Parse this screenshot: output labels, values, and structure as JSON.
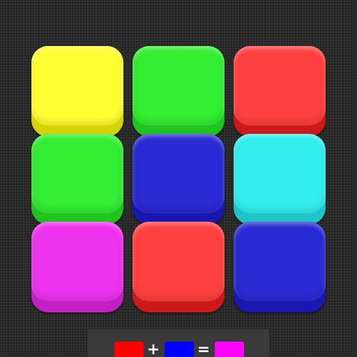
{
  "game": {
    "tiles": [
      {
        "color_name": "yellow",
        "top": "#ffff33",
        "side": "#d4d400"
      },
      {
        "color_name": "green",
        "top": "#33ee33",
        "side": "#1fc41f"
      },
      {
        "color_name": "red",
        "top": "#ff4040",
        "side": "#cc1a1a"
      },
      {
        "color_name": "green",
        "top": "#33ee33",
        "side": "#1fc41f"
      },
      {
        "color_name": "blue",
        "top": "#2a2ad4",
        "side": "#1818b0"
      },
      {
        "color_name": "cyan",
        "top": "#33eeee",
        "side": "#1fc4c4"
      },
      {
        "color_name": "magenta",
        "top": "#ee33ee",
        "side": "#c41fc4"
      },
      {
        "color_name": "red",
        "top": "#ff4040",
        "side": "#cc1a1a"
      },
      {
        "color_name": "blue",
        "top": "#2a2ad4",
        "side": "#1818b0"
      }
    ]
  },
  "formula": {
    "left_color": "#ff0000",
    "plus_symbol": "+",
    "right_color": "#0000ff",
    "equals_symbol": "=",
    "result_color": "#ff00ff"
  }
}
